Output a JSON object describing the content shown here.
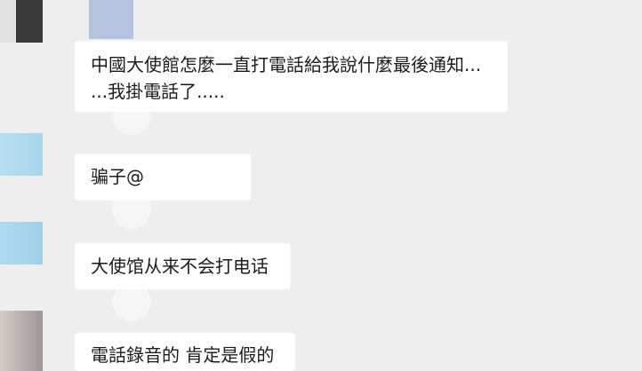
{
  "messages": [
    {
      "lines": [
        "中國大使館怎麼一直打電話給我說什麼最後通知...",
        "...我掛電話了....."
      ]
    },
    {
      "lines": [
        "骗子@"
      ]
    },
    {
      "lines": [
        "大使馆从来不会打电话"
      ]
    },
    {
      "lines": [
        "電話錄音的 肯定是假的"
      ]
    }
  ]
}
